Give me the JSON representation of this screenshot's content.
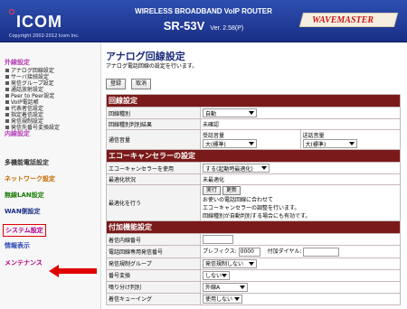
{
  "header": {
    "logo_text": "ICOM",
    "copyright": "Copyright 2002-2012 Icom Inc.",
    "product_line": "WIRELESS BROADBAND VoIP ROUTER",
    "model": "SR-53V",
    "version": "Ver. 2.58(P)",
    "brand": "WAVEMASTER"
  },
  "sidebar": {
    "sections": [
      {
        "title": "外線設定",
        "items": [
          "アナログ回線設定",
          "サーバ接続設定",
          "発信グループ設定",
          "通話放射設定",
          "Peer to Peer設定",
          "VoIP電話帳",
          "代表者信設定",
          "指定着信設定",
          "発信規制設定",
          "発信先番号変換設定"
        ]
      },
      {
        "title": "内線設定",
        "items": []
      }
    ],
    "menu": [
      {
        "label": "多機能電話設定",
        "color": "#333333"
      },
      {
        "label": "ネットワーク設定",
        "color": "#c76800"
      },
      {
        "label": "無線LAN設定",
        "color": "#1c7a0a"
      },
      {
        "label": "WAN側設定",
        "color": "#1a2f86"
      },
      {
        "label": "システム設定",
        "color": "#b3008f"
      },
      {
        "label": "情報表示",
        "color": "#2e47b5"
      },
      {
        "label": "メンテナンス",
        "color": "#b0007e"
      }
    ]
  },
  "main": {
    "title": "アナログ回線設定",
    "subtitle": "アナログ電話回線の設定を行います。",
    "buttons": {
      "register": "登録",
      "cancel": "取消"
    },
    "sections": {
      "line": "回線設定",
      "echo": "エコーキャンセラーの設定",
      "extra": "付加機能設定"
    },
    "rows": {
      "line_type": {
        "label": "回線種別",
        "value": "自動"
      },
      "line_detect": {
        "label": "回線種別判別結果",
        "value": "未確認"
      },
      "volume": {
        "label": "通信音量",
        "rx_label": "受話音量",
        "rx_value": "大(標準)",
        "tx_label": "送話音量",
        "tx_value": "大(標準)"
      },
      "echo_use": {
        "label": "エコーキャンセラーを使用",
        "value": "する(起動時最適化)"
      },
      "opt_status": {
        "label": "最適化状況",
        "value": "未最適化"
      },
      "opt_run": {
        "label": "最適化を行う",
        "exec": "実行",
        "update": "更新",
        "note1": "お使いの電話回線に合わせて",
        "note2": "エコーキャンセラーの調整を行います。",
        "note3": "回線種別が自動判別する場合にも有効です。"
      },
      "ext_num": {
        "label": "着信内線番号",
        "value": ""
      },
      "caller_num": {
        "label": "電話回線専用発信番号",
        "prefix_label": "プレフィクス:",
        "prefix_value": "0000",
        "dial_label": "付加ダイヤル:",
        "dial_value": ""
      },
      "out_group": {
        "label": "発信規制グループ",
        "value": "発信規制しない"
      },
      "num_convert": {
        "label": "番号変換",
        "value": "しない"
      },
      "split": {
        "label": "鳴り分け判別",
        "value": "外線A"
      },
      "queue": {
        "label": "着信キューイング",
        "value": "使用しない"
      }
    }
  }
}
